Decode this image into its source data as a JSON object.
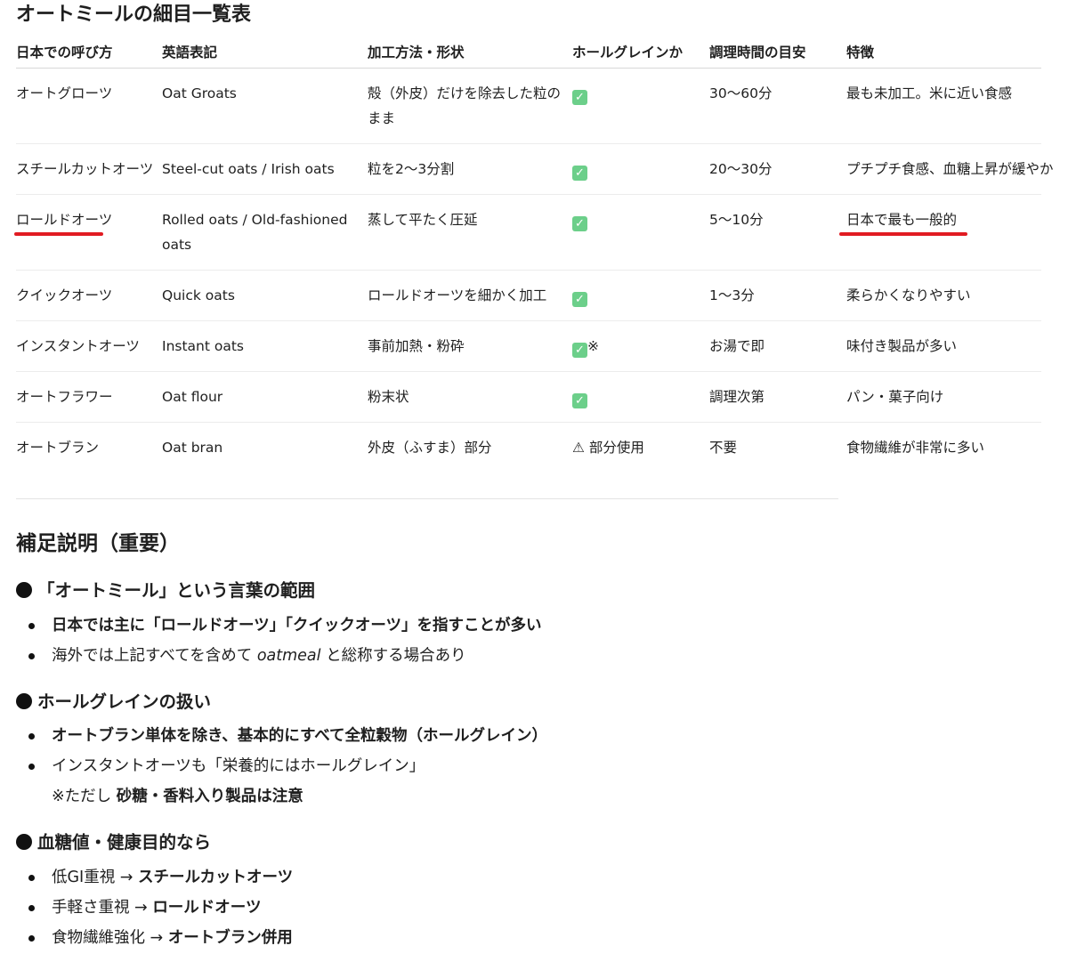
{
  "title": "オートミールの細目一覧表",
  "table": {
    "headers": [
      "日本での呼び方",
      "英語表記",
      "加工方法・形状",
      "ホールグレインか",
      "調理時間の目安",
      "特徴"
    ],
    "rows": [
      {
        "ja": "オートグローツ",
        "en": "Oat Groats",
        "method": "殻（外皮）だけを除去した粒のまま",
        "whole_check": true,
        "whole_text": "",
        "time": "30〜60分",
        "feature": "最も未加工。米に近い食感"
      },
      {
        "ja": "スチールカットオーツ",
        "en": "Steel-cut oats / Irish oats",
        "method": "粒を2〜3分割",
        "whole_check": true,
        "whole_text": "",
        "time": "20〜30分",
        "feature": "プチプチ食感、血糖上昇が緩やか"
      },
      {
        "ja": "ロールドオーツ",
        "en": "Rolled oats / Old-fashioned oats",
        "method": "蒸して平たく圧延",
        "whole_check": true,
        "whole_text": "",
        "time": "5〜10分",
        "feature": "日本で最も一般的"
      },
      {
        "ja": "クイックオーツ",
        "en": "Quick oats",
        "method": "ロールドオーツを細かく加工",
        "whole_check": true,
        "whole_text": "",
        "time": "1〜3分",
        "feature": "柔らかくなりやすい"
      },
      {
        "ja": "インスタントオーツ",
        "en": "Instant oats",
        "method": "事前加熱・粉砕",
        "whole_check": true,
        "whole_text": "※",
        "time": "お湯で即",
        "feature": "味付き製品が多い"
      },
      {
        "ja": "オートフラワー",
        "en": "Oat flour",
        "method": "粉末状",
        "whole_check": true,
        "whole_text": "",
        "time": "調理次第",
        "feature": "パン・菓子向け"
      },
      {
        "ja": "オートブラン",
        "en": "Oat bran",
        "method": "外皮（ふすま）部分",
        "whole_check": false,
        "whole_text": "⚠ 部分使用",
        "time": "不要",
        "feature": "食物繊維が非常に多い"
      }
    ]
  },
  "notes": {
    "heading": "補足説明（重要）",
    "s1": {
      "heading": "「オートミール」という言葉の範囲",
      "i1": "日本では主に「ロールドオーツ」「クイックオーツ」を指すことが多い",
      "i2_a": "海外では上記すべてを含めて",
      "i2_b": "oatmeal",
      "i2_c": "と総称する場合あり"
    },
    "s2": {
      "heading": "ホールグレインの扱い",
      "i1": "オートブラン単体を除き、基本的にすべて全粒穀物（ホールグレイン）",
      "i2": "インスタントオーツも「栄養的にはホールグレイン」",
      "i3_a": "※ただし",
      "i3_b": "砂糖・香料入り製品は注意"
    },
    "s3": {
      "heading": "血糖値・健康目的なら",
      "i1_a": "低GI重視 →",
      "i1_b": "スチールカットオーツ",
      "i2_a": "手軽さ重視 →",
      "i2_b": "ロールドオーツ",
      "i3_a": "食物繊維強化 →",
      "i3_b": "オートブラン併用"
    }
  },
  "colors": {
    "check": "#6ccf8a",
    "annotation": "#e11b22"
  },
  "icons": {
    "check": "white-check-mark-icon",
    "bullet": "black-circle-icon"
  }
}
